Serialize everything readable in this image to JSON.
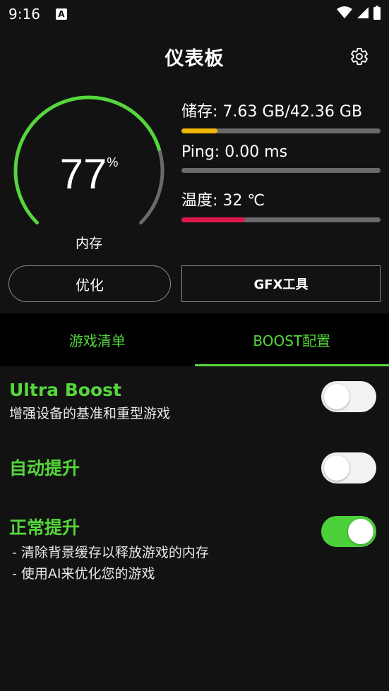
{
  "status_bar": {
    "time": "9:16",
    "notification_letter": "A"
  },
  "header": {
    "title": "仪表板"
  },
  "gauge": {
    "value": "77",
    "unit": "%",
    "label": "内存",
    "fraction": 0.77
  },
  "metrics": [
    {
      "label": "储存: 7.63 GB/42.36 GB",
      "fraction": 0.18,
      "color": "#f2b705"
    },
    {
      "label": "Ping: 0.00 ms",
      "fraction": 0.0,
      "color": "#55d63c"
    },
    {
      "label": "温度: 32 ℃",
      "fraction": 0.32,
      "color": "#e0174f"
    }
  ],
  "buttons": {
    "optimize": "优化",
    "gfx": "GFX工具"
  },
  "tabs": [
    {
      "label": "游戏清单",
      "active": false
    },
    {
      "label": "BOOST配置",
      "active": true
    }
  ],
  "settings": [
    {
      "title": "Ultra Boost",
      "desc": [
        "增强设备的基准和重型游戏"
      ],
      "on": false
    },
    {
      "title": "自动提升",
      "desc": [],
      "on": false
    },
    {
      "title": "正常提升",
      "desc": [
        "- 清除背景缓存以释放游戏的内存",
        "- 使用AI来优化您的游戏"
      ],
      "on": true
    }
  ],
  "colors": {
    "accent": "#55d63c",
    "background": "#121212",
    "track": "#6a6a6a"
  }
}
